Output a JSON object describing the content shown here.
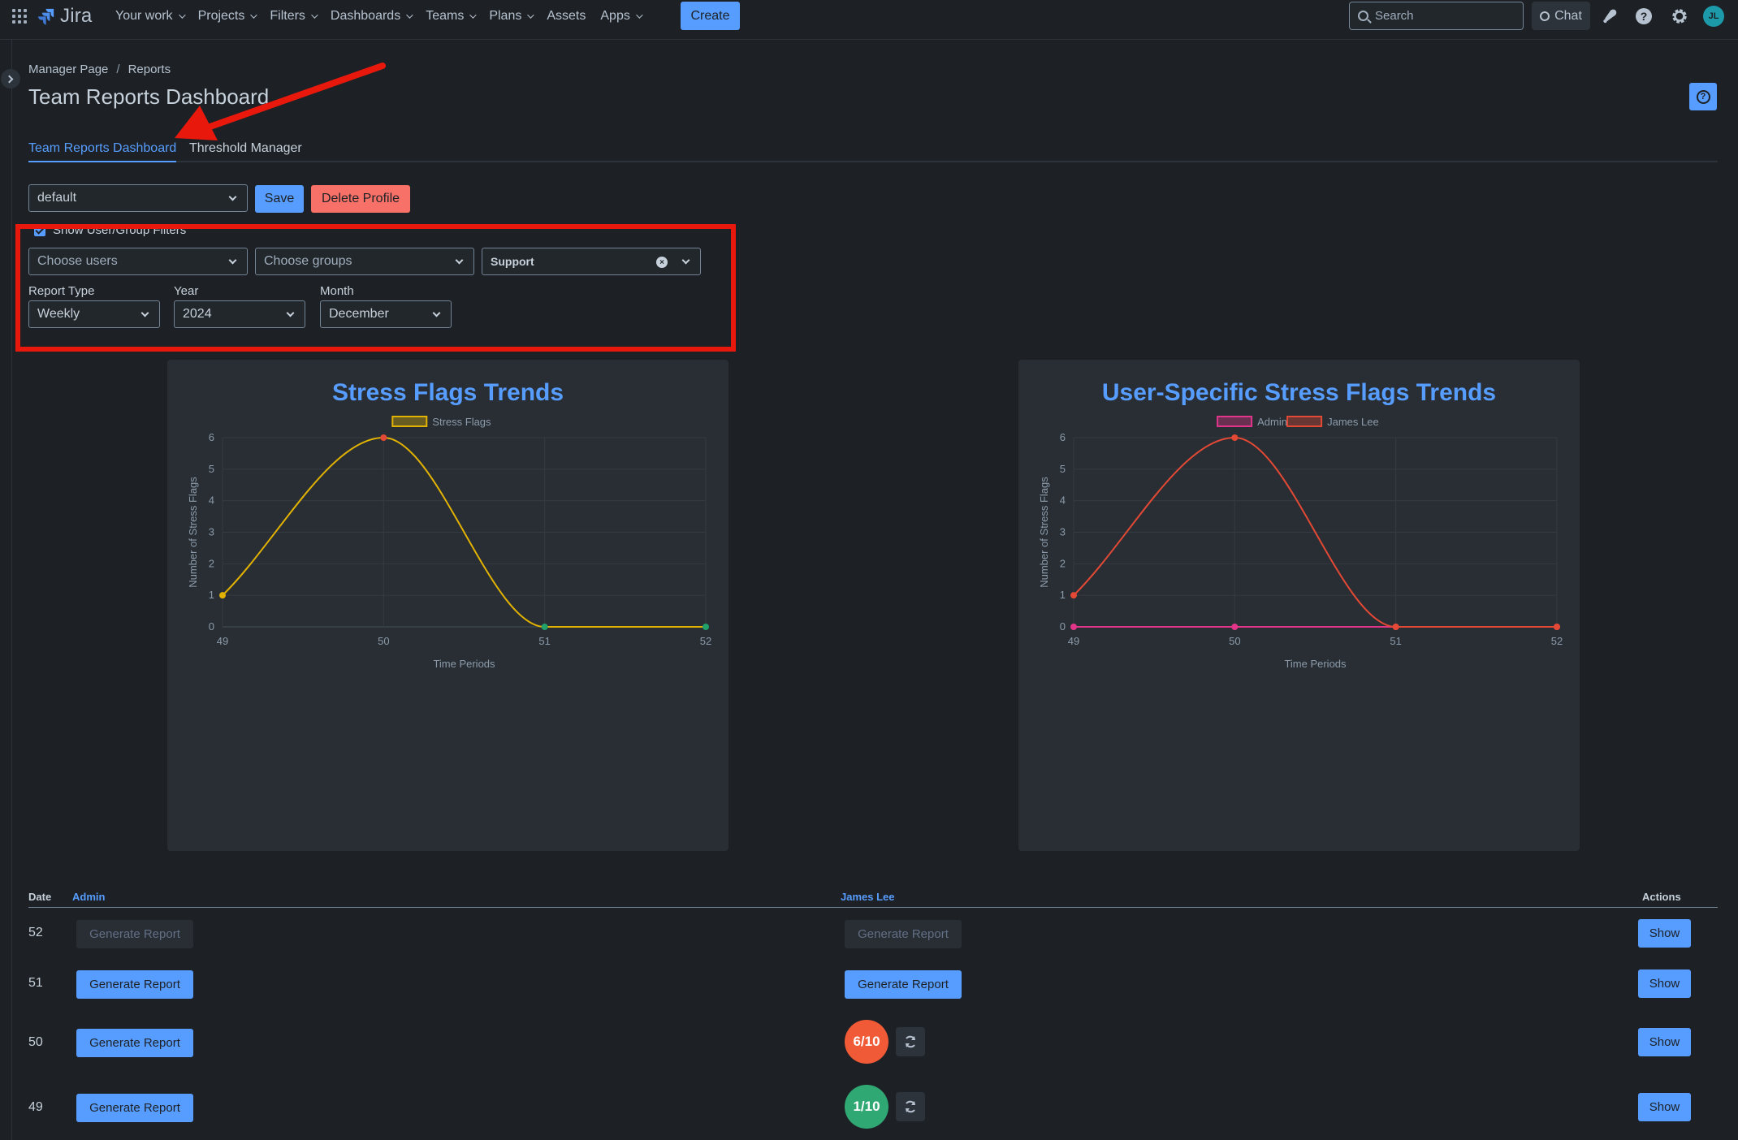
{
  "nav": {
    "logo": "Jira",
    "items": [
      {
        "label": "Your work",
        "dropdown": true
      },
      {
        "label": "Projects",
        "dropdown": true
      },
      {
        "label": "Filters",
        "dropdown": true
      },
      {
        "label": "Dashboards",
        "dropdown": true
      },
      {
        "label": "Teams",
        "dropdown": true
      },
      {
        "label": "Plans",
        "dropdown": true
      },
      {
        "label": "Assets",
        "dropdown": false
      },
      {
        "label": "Apps",
        "dropdown": true
      }
    ],
    "create_label": "Create",
    "search_placeholder": "Search",
    "chat_label": "Chat",
    "avatar_initials": "JL",
    "icons": [
      "apps-grid-icon",
      "notifications-icon",
      "help-icon",
      "settings-icon"
    ]
  },
  "breadcrumb": [
    "Manager Page",
    "Reports"
  ],
  "page_title": "Team Reports Dashboard",
  "tabs": [
    {
      "label": "Team Reports Dashboard",
      "active": true
    },
    {
      "label": "Threshold Manager",
      "active": false
    }
  ],
  "profile": {
    "selected": "default",
    "save_label": "Save",
    "delete_label": "Delete Profile"
  },
  "filters": {
    "show_filters_label": "Show User/Group Filters",
    "show_filters_checked": true,
    "users_placeholder": "Choose users",
    "groups_placeholder": "Choose groups",
    "selected_group": "Support",
    "report_type_label": "Report Type",
    "report_type": "Weekly",
    "year_label": "Year",
    "year": "2024",
    "month_label": "Month",
    "month": "December"
  },
  "chart_data": [
    {
      "type": "line",
      "title": "Stress Flags Trends",
      "xlabel": "Time Periods",
      "ylabel": "Number of Stress Flags",
      "x": [
        49,
        50,
        51,
        52
      ],
      "ylim": [
        0,
        6
      ],
      "yticks": [
        0,
        1,
        2,
        3,
        4,
        5,
        6
      ],
      "legend": "top",
      "grid": true,
      "series": [
        {
          "name": "Stress Flags",
          "values": [
            1,
            6,
            0,
            0
          ],
          "color": "#e2b203"
        }
      ]
    },
    {
      "type": "line",
      "title": "User-Specific Stress Flags Trends",
      "xlabel": "Time Periods",
      "ylabel": "Number of Stress Flags",
      "x": [
        49,
        50,
        51,
        52
      ],
      "ylim": [
        0,
        6
      ],
      "yticks": [
        0,
        1,
        2,
        3,
        4,
        5,
        6
      ],
      "legend": "top",
      "grid": true,
      "series": [
        {
          "name": "Admin",
          "values": [
            0,
            0,
            0,
            0
          ],
          "color": "#e2358a"
        },
        {
          "name": "James Lee",
          "values": [
            1,
            6,
            0,
            0
          ],
          "color": "#e34935"
        }
      ]
    }
  ],
  "table": {
    "headers": {
      "date": "Date",
      "admin": "Admin",
      "james": "James Lee",
      "actions": "Actions"
    },
    "generate_label": "Generate Report",
    "show_label": "Show",
    "rows": [
      {
        "date": "52",
        "admin": "disabled",
        "james": "disabled"
      },
      {
        "date": "51",
        "admin": "enabled",
        "james": "enabled"
      },
      {
        "date": "50",
        "admin": "enabled",
        "james_score": "6/10",
        "james_color": "#f15a36"
      },
      {
        "date": "49",
        "admin": "enabled",
        "james_score": "1/10",
        "james_color": "#2fa874"
      }
    ]
  }
}
